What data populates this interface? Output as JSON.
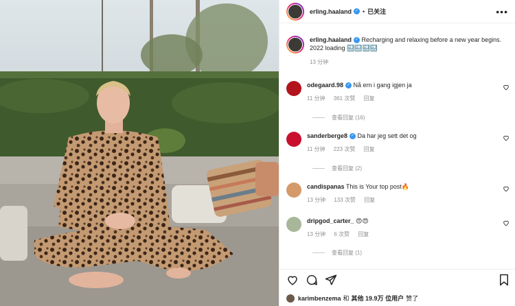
{
  "header": {
    "username": "erling.haaland",
    "separator": "•",
    "follow_label": "已关注",
    "more_label": "•••"
  },
  "caption": {
    "username": "erling.haaland",
    "text": "Recharging and relaxing before a new year begins. 2022 loading 🔜🔜🔜🔜",
    "time": "13 分钟"
  },
  "comments": [
    {
      "username": "odegaard.98",
      "verified": true,
      "text": "Nå ern i gang igjen ja",
      "time": "11 分钟",
      "likes": "361 次赞",
      "reply": "回复",
      "view_replies": "查看回复 (16)"
    },
    {
      "username": "sanderberge8",
      "verified": true,
      "text": "Da har jeg sett det og",
      "time": "11 分钟",
      "likes": "223 次赞",
      "reply": "回复",
      "view_replies": "查看回复 (2)"
    },
    {
      "username": "candispanas",
      "verified": false,
      "text": "This is Your top post🔥",
      "time": "13 分钟",
      "likes": "133 次赞",
      "reply": "回复",
      "view_replies": ""
    },
    {
      "username": "dripgod_carter_",
      "verified": false,
      "text": "😍😍",
      "time": "13 分钟",
      "likes": "6 次赞",
      "reply": "回复",
      "view_replies": "查看回复 (1)"
    }
  ],
  "likes_line": {
    "user": "karimbenzema",
    "and": "和",
    "others": "其他 19.9万 位用户",
    "suffix": "赞了"
  },
  "icons": [
    "heart-icon",
    "comment-icon",
    "share-icon",
    "bookmark-icon",
    "verified-icon",
    "more-icon"
  ],
  "colors": {
    "verified": "#3897f0",
    "muted": "#8e8e8e",
    "text": "#262626"
  }
}
